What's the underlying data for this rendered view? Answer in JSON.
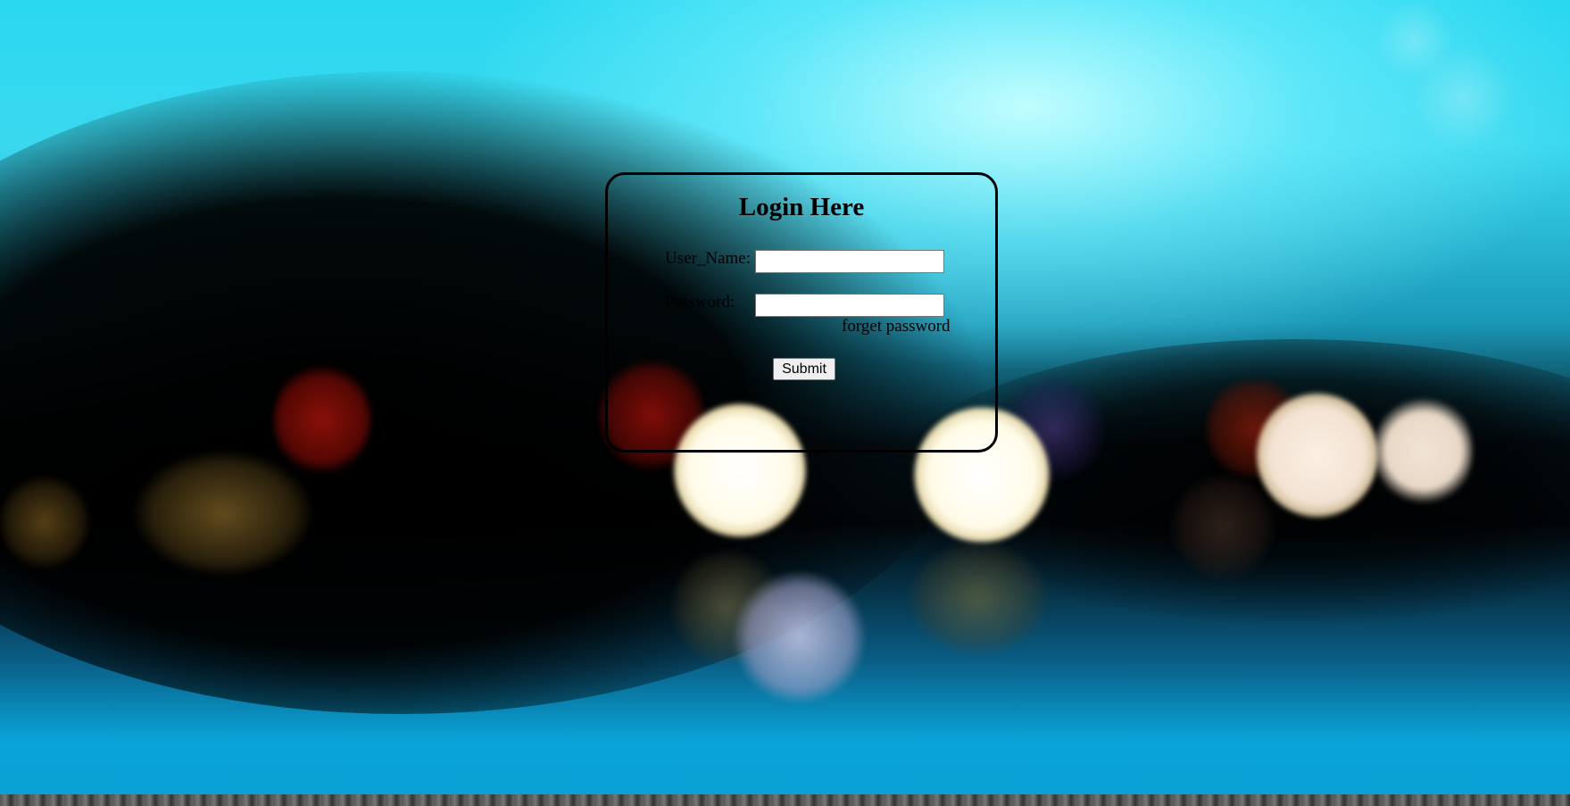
{
  "login": {
    "title": "Login Here",
    "username_label": "User_Name:",
    "username_value": "",
    "password_label": "Password:",
    "password_value": "",
    "forgot_label": "forget password",
    "submit_label": "Submit"
  }
}
